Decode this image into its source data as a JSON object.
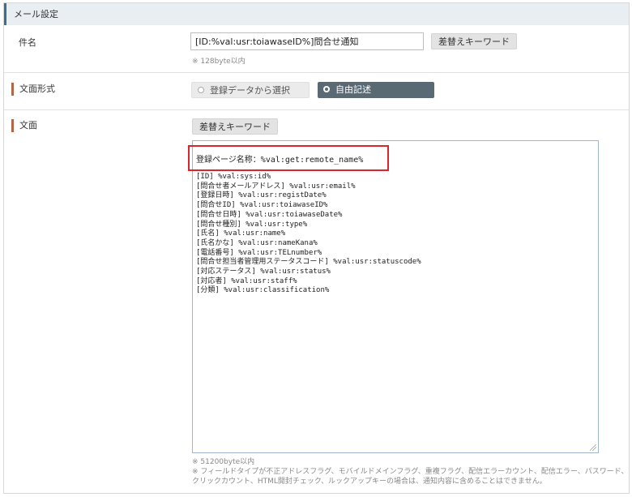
{
  "section": {
    "title": "メール設定"
  },
  "subject": {
    "label": "件名",
    "value": "[ID:%val:usr:toiawaseID%]問合せ通知",
    "keyword_button": "差替えキーワード",
    "note": "※ 128byte以内"
  },
  "format": {
    "label": "文面形式",
    "options": [
      {
        "label": "登録データから選択",
        "selected": false
      },
      {
        "label": "自由記述",
        "selected": true
      }
    ]
  },
  "body": {
    "label": "文面",
    "keyword_button": "差替えキーワード",
    "first_line": "登録ページ名称：%val:get:remote_name%",
    "lines": [
      "[ID] %val:sys:id%",
      "[問合せ者メールアドレス] %val:usr:email%",
      "[登録日時] %val:usr:registDate%",
      "[問合せID] %val:usr:toiawaseID%",
      "[問合せ日時] %val:usr:toiawaseDate%",
      "[問合せ種別] %val:usr:type%",
      "[氏名] %val:usr:name%",
      "[氏名かな] %val:usr:nameKana%",
      "[電話番号] %val:usr:TELnumber%",
      "[問合せ担当者管理用ステータスコード] %val:usr:statuscode%",
      "[対応ステータス] %val:usr:status%",
      "[対応者] %val:usr:staff%",
      "[分類] %val:usr:classification%"
    ],
    "size_note": "※ 51200byte以内",
    "field_note": "※ フィールドタイプが不正アドレスフラグ、モバイルドメインフラグ、重複フラグ、配信エラーカウント、配信エラー、パスワード、クリックカウント、HTML開封チェック、ルックアップキーの場合は、通知内容に含めることはできません。"
  },
  "colors": {
    "highlight": "#d9262c",
    "selected_radio": "#5a6a75",
    "section_accent": "#3d6f86",
    "row_accent": "#b2674a"
  }
}
